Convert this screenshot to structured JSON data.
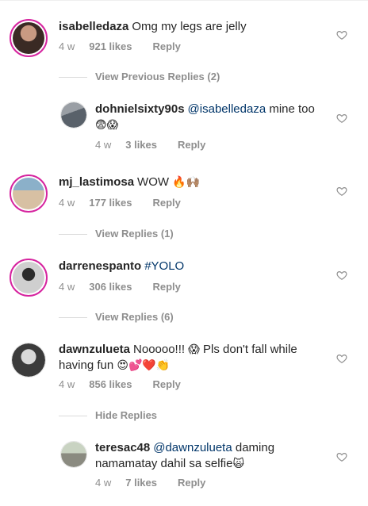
{
  "comments": [
    {
      "username": "isabelledaza",
      "text": "Omg my legs are jelly",
      "time": "4 w",
      "likes": "921 likes",
      "reply": "Reply"
    },
    {
      "username": "dohnielsixty90s",
      "mention": "@isabelledaza",
      "text": " mine too",
      "emoji": "😨😱",
      "time": "4 w",
      "likes": "3 likes",
      "reply": "Reply"
    },
    {
      "username": "mj_lastimosa",
      "text": "WOW ",
      "emoji": "🔥🙌🏽",
      "time": "4 w",
      "likes": "177 likes",
      "reply": "Reply"
    },
    {
      "username": "darrenespanto",
      "tag": "#YOLO",
      "time": "4 w",
      "likes": "306 likes",
      "reply": "Reply"
    },
    {
      "username": "dawnzulueta",
      "text": "Nooooo!!! ",
      "emoji1": "😱",
      "text2": " Pls don't fall while having fun ",
      "emoji2": "😍💕❤️👏",
      "time": "4 w",
      "likes": "856 likes",
      "reply": "Reply"
    },
    {
      "username": "teresac48",
      "mention": "@dawnzulueta",
      "text": " daming namamatay dahil sa selfie",
      "emoji": "🙀",
      "time": "4 w",
      "likes": "7 likes",
      "reply": "Reply"
    }
  ],
  "toggles": {
    "view_previous": "View Previous Replies (2)",
    "view_replies_1": "View Replies (1)",
    "view_replies_6": "View Replies (6)",
    "hide_replies": "Hide Replies"
  },
  "icons": {
    "like": "heart-outline-icon"
  },
  "colors": {
    "link": "#003569",
    "muted": "#8e8e8e",
    "story_ring": "#d6249f"
  }
}
